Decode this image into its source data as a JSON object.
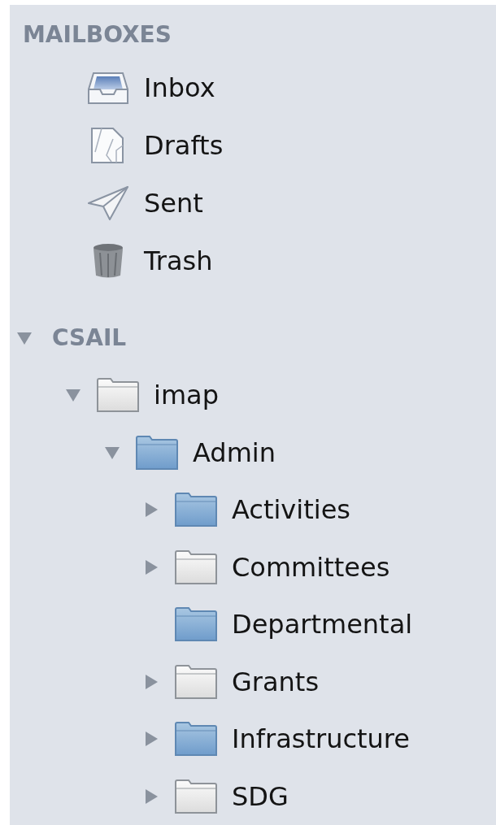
{
  "mailboxes": {
    "heading": "MAILBOXES",
    "items": [
      {
        "kind": "inbox",
        "label": "Inbox"
      },
      {
        "kind": "drafts",
        "label": "Drafts"
      },
      {
        "kind": "sent",
        "label": "Sent"
      },
      {
        "kind": "trash",
        "label": "Trash"
      }
    ]
  },
  "account": {
    "name": "CSAIL",
    "expanded": true,
    "folders": [
      {
        "label": "imap",
        "kind": "plain",
        "has_children": true,
        "expanded": true,
        "children": [
          {
            "label": "Admin",
            "kind": "blue",
            "has_children": true,
            "expanded": true,
            "children": [
              {
                "label": "Activities",
                "kind": "blue",
                "has_children": true,
                "expanded": false
              },
              {
                "label": "Committees",
                "kind": "plain",
                "has_children": true,
                "expanded": false
              },
              {
                "label": "Departmental",
                "kind": "blue",
                "has_children": false,
                "expanded": false
              },
              {
                "label": "Grants",
                "kind": "plain",
                "has_children": true,
                "expanded": false
              },
              {
                "label": "Infrastructure",
                "kind": "blue",
                "has_children": true,
                "expanded": false
              },
              {
                "label": "SDG",
                "kind": "plain",
                "has_children": true,
                "expanded": false
              }
            ]
          }
        ]
      }
    ]
  }
}
